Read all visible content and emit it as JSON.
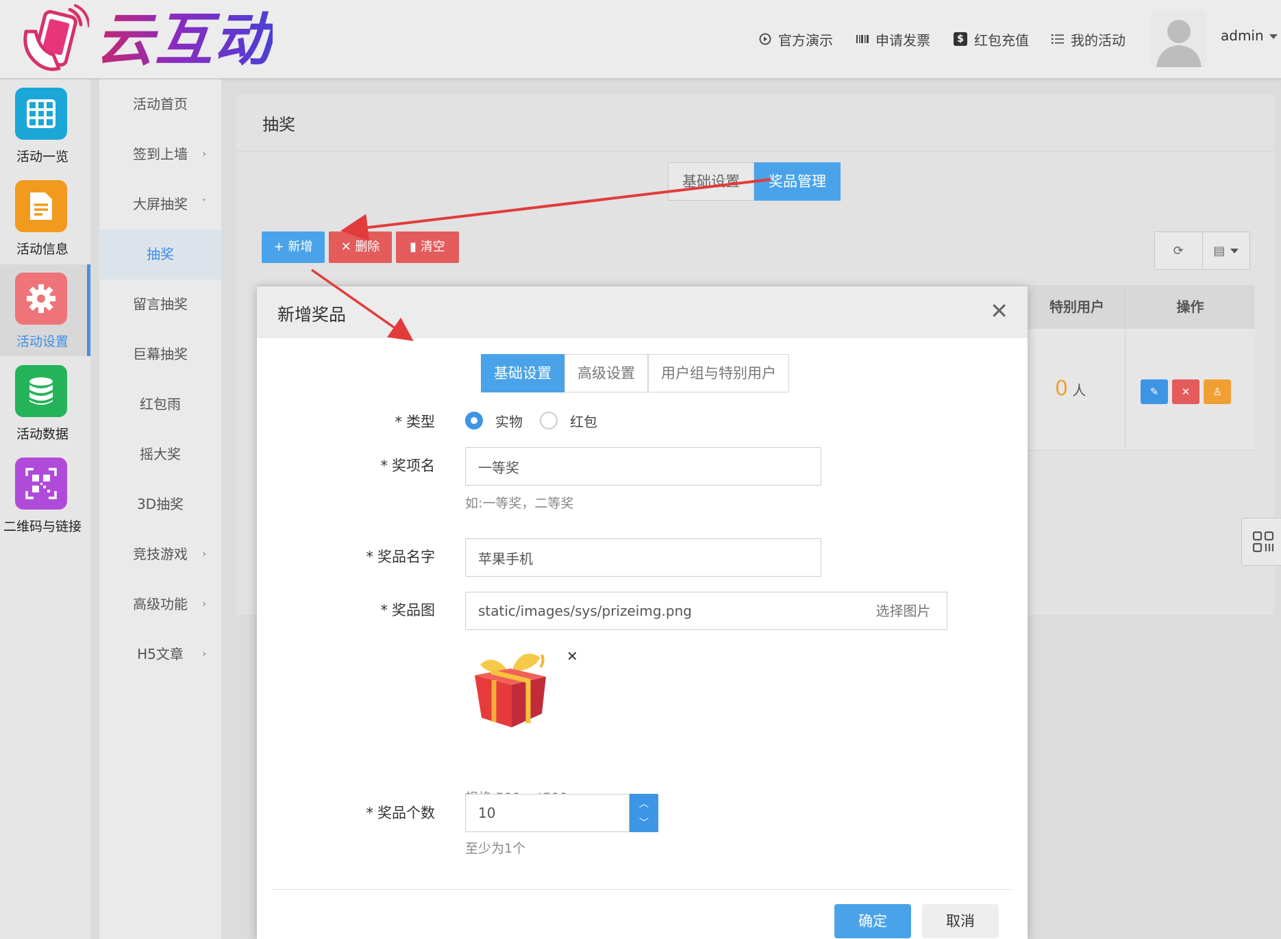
{
  "brand": {
    "name": "云互动"
  },
  "topnav": [
    {
      "label": "官方演示",
      "icon": "play-circle-icon"
    },
    {
      "label": "申请发票",
      "icon": "barcode-icon"
    },
    {
      "label": "红包充值",
      "icon": "dollar-icon"
    },
    {
      "label": "我的活动",
      "icon": "list-icon"
    }
  ],
  "user": {
    "name": "admin"
  },
  "icon_sidebar": [
    {
      "label": "活动一览",
      "icon": "grid-icon",
      "color": "#1aa6d6"
    },
    {
      "label": "活动信息",
      "icon": "document-icon",
      "color": "#f29a1d"
    },
    {
      "label": "活动设置",
      "icon": "gear-icon",
      "color": "#ee7479"
    },
    {
      "label": "活动数据",
      "icon": "database-icon",
      "color": "#25b35a"
    },
    {
      "label": "二维码与链接",
      "icon": "qrcode-icon",
      "color": "#b04bd9"
    }
  ],
  "submenu": [
    {
      "label": "活动首页"
    },
    {
      "label": "签到上墙",
      "chevron": "›"
    },
    {
      "label": "大屏抽奖",
      "chevron": "ˇ"
    },
    {
      "label": "抽奖"
    },
    {
      "label": "留言抽奖"
    },
    {
      "label": "巨幕抽奖"
    },
    {
      "label": "红包雨"
    },
    {
      "label": "摇大奖"
    },
    {
      "label": "3D抽奖"
    },
    {
      "label": "竞技游戏",
      "chevron": "›"
    },
    {
      "label": "高级功能",
      "chevron": "›"
    },
    {
      "label": "H5文章",
      "chevron": "›"
    }
  ],
  "panel": {
    "title": "抽奖",
    "tabs": [
      "基础设置",
      "奖品管理"
    ],
    "toolbar": {
      "add": "新增",
      "delete": "删除",
      "clear": "清空"
    },
    "table": {
      "headers": [
        "特别用户",
        "操作"
      ],
      "row": {
        "special_count": "0",
        "special_unit": "人"
      }
    }
  },
  "modal": {
    "title": "新增奖品",
    "tabs": [
      "基础设置",
      "高级设置",
      "用户组与特别用户"
    ],
    "type": {
      "label": "类型",
      "options": [
        "实物",
        "红包"
      ],
      "selected": "实物"
    },
    "item_name": {
      "label": "奖项名",
      "value": "一等奖",
      "help": "如:一等奖，二等奖"
    },
    "prize_name": {
      "label": "奖品名字",
      "value": "苹果手机"
    },
    "prize_image": {
      "label": "奖品图",
      "value": "static/images/sys/prizeimg.png",
      "button": "选择图片",
      "help": "规格:500px*500px"
    },
    "prize_count": {
      "label": "奖品个数",
      "value": "10",
      "help": "至少为1个"
    },
    "confirm": "确定",
    "cancel": "取消"
  }
}
